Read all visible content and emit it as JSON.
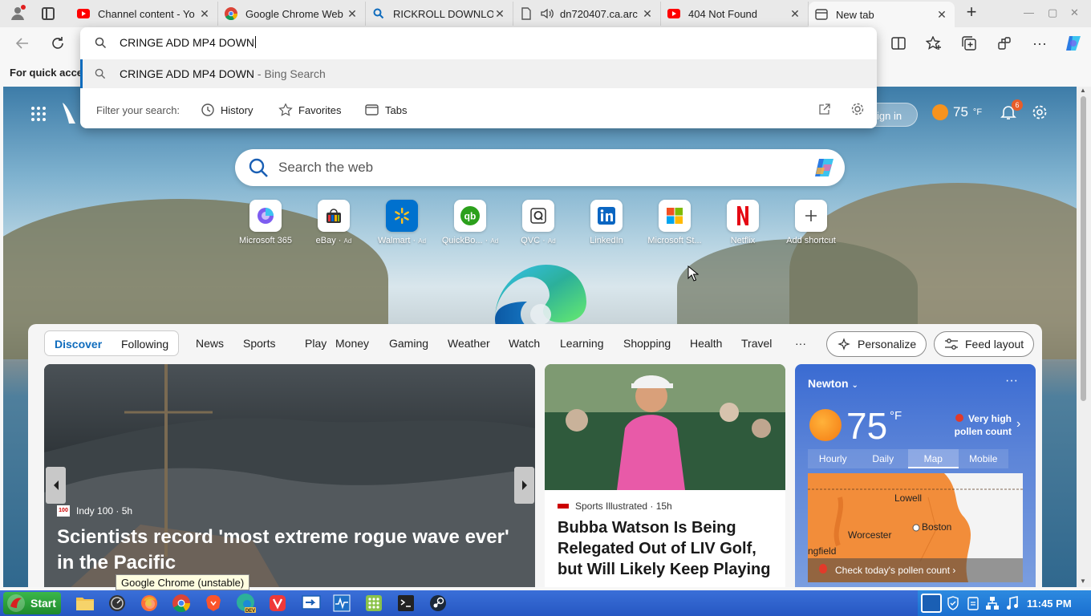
{
  "tabs": [
    {
      "title": "Channel content - Yo",
      "favicon": "youtube-icon",
      "color": "#ff0000"
    },
    {
      "title": "Google Chrome Web",
      "favicon": "chrome-icon",
      "color": "#4285f4"
    },
    {
      "title": "RICKROLL DOWNLO",
      "favicon": "search-icon",
      "color": "#0f6cbd"
    },
    {
      "title": "dn720407.ca.arc",
      "favicon": "document-icon",
      "color": "#555555"
    },
    {
      "title": "404 Not Found",
      "favicon": "youtube-icon",
      "color": "#ff0000"
    },
    {
      "title": "New tab",
      "favicon": "newtab-icon",
      "color": "#555555"
    }
  ],
  "bookmark_bar": {
    "text": "For quick acce"
  },
  "omnibox": {
    "input": "CRINGE ADD MP4 DOWN",
    "suggestion": "CRINGE ADD MP4 DOWN",
    "suggestion_sub": " - Bing Search",
    "filter_label": "Filter your search:",
    "filters": [
      "History",
      "Favorites",
      "Tabs"
    ]
  },
  "ntp": {
    "signin": "ign in",
    "weather_temp": "75",
    "weather_unit": "°F",
    "notifications": "6",
    "search_placeholder": "Search the web",
    "shortcuts": [
      {
        "label": "Microsoft 365",
        "ad": ""
      },
      {
        "label": "eBay",
        "ad": "Ad"
      },
      {
        "label": "Walmart",
        "ad": "Ad"
      },
      {
        "label": "QuickBo...",
        "ad": "Ad"
      },
      {
        "label": "QVC",
        "ad": "Ad"
      },
      {
        "label": "LinkedIn",
        "ad": ""
      },
      {
        "label": "Microsoft St...",
        "ad": ""
      },
      {
        "label": "Netflix",
        "ad": ""
      },
      {
        "label": "Add shortcut",
        "ad": ""
      }
    ]
  },
  "feed": {
    "toggle": [
      "Discover",
      "Following"
    ],
    "nav": [
      "News",
      "Sports",
      "Play",
      "Money",
      "Gaming",
      "Weather",
      "Watch",
      "Learning",
      "Shopping",
      "Health",
      "Travel",
      "···"
    ],
    "personalize": "Personalize",
    "layout": "Feed layout",
    "main_card": {
      "source": "Indy 100 · 5h",
      "logo": "100",
      "headline": "Scientists record 'most extreme rogue wave ever' in the Pacific"
    },
    "golf_card": {
      "source": "Sports Illustrated · 15h",
      "headline": "Bubba Watson Is Being Relegated Out of LIV Golf, but Will Likely Keep Playing"
    },
    "weather_card": {
      "city": "Newton",
      "temp": "75",
      "unit": "°F",
      "pollen": "Very high pollen count",
      "tabs": [
        "Hourly",
        "Daily",
        "Map",
        "Mobile"
      ],
      "selected_tab": "Map",
      "map_labels": [
        "Lowell",
        "Worcester",
        "Boston",
        "ngfield"
      ],
      "cta": "Check today's pollen count"
    }
  },
  "tooltip": "Google Chrome (unstable)",
  "taskbar": {
    "start": "Start",
    "clock": "11:45 PM"
  }
}
